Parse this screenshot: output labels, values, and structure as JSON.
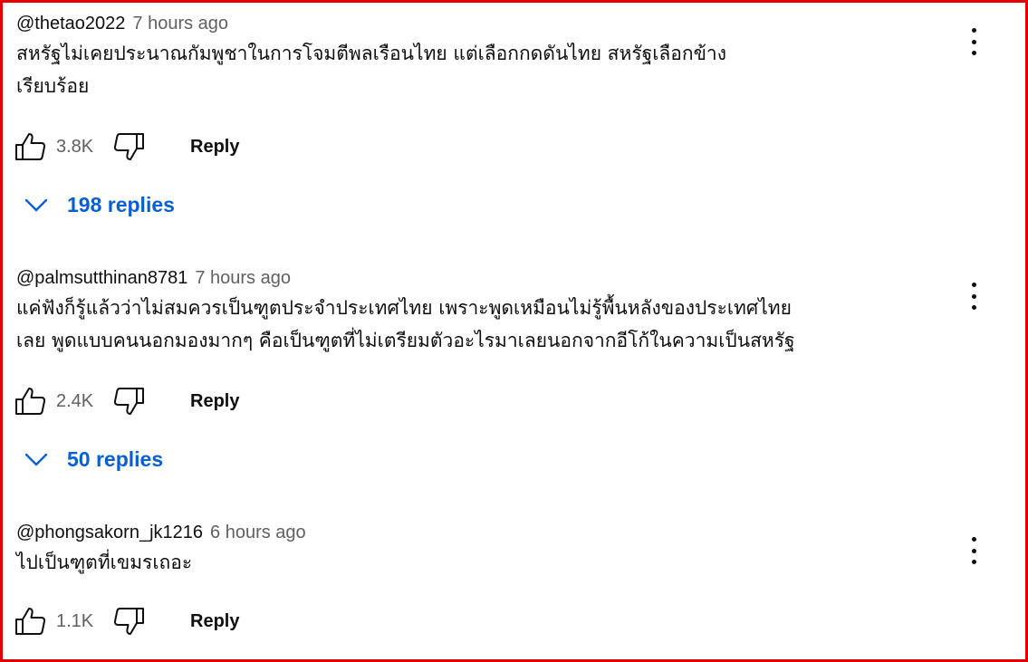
{
  "comments": [
    {
      "author": "@thetao2022",
      "time": "7 hours ago",
      "text_lines": [
        "สหรัฐไม่เคยประนาณกัมพูชาในการโจมตีพลเรือนไทย แต่เลือกกดดันไทย สหรัฐเลือกข้าง",
        "เรียบร้อย"
      ],
      "likes": "3.8K",
      "reply_label": "Reply",
      "replies_label": "198 replies",
      "menu_icon": "more-vert-icon"
    },
    {
      "author": "@palmsutthinan8781",
      "time": "7 hours ago",
      "text_lines": [
        "แค่ฟังก็รู้แล้วว่าไม่สมควรเป็นฑูตประจำประเทศไทย เพราะพูดเหมือนไม่รู้พื้นหลังของประเทศไทย",
        "เลย พูดแบบคนนอกมองมากๆ คือเป็นฑูตที่ไม่เตรียมตัวอะไรมาเลยนอกจากอีโก้ในความเป็นสหรัฐ"
      ],
      "likes": "2.4K",
      "reply_label": "Reply",
      "replies_label": "50 replies",
      "menu_icon": "more-vert-icon"
    },
    {
      "author": "@phongsakorn_jk1216",
      "time": "6 hours ago",
      "text_lines": [
        "ไปเป็นฑูตที่เขมรเถอะ"
      ],
      "likes": "1.1K",
      "reply_label": "Reply",
      "menu_icon": "more-vert-icon"
    }
  ],
  "colors": {
    "frame_border": "#e30000",
    "link_blue": "#065fd4",
    "secondary_text": "#606060",
    "primary_text": "#0f0f0f"
  },
  "icons": [
    "thumb-up-icon",
    "thumb-down-icon",
    "chevron-down-icon",
    "more-vert-icon"
  ]
}
